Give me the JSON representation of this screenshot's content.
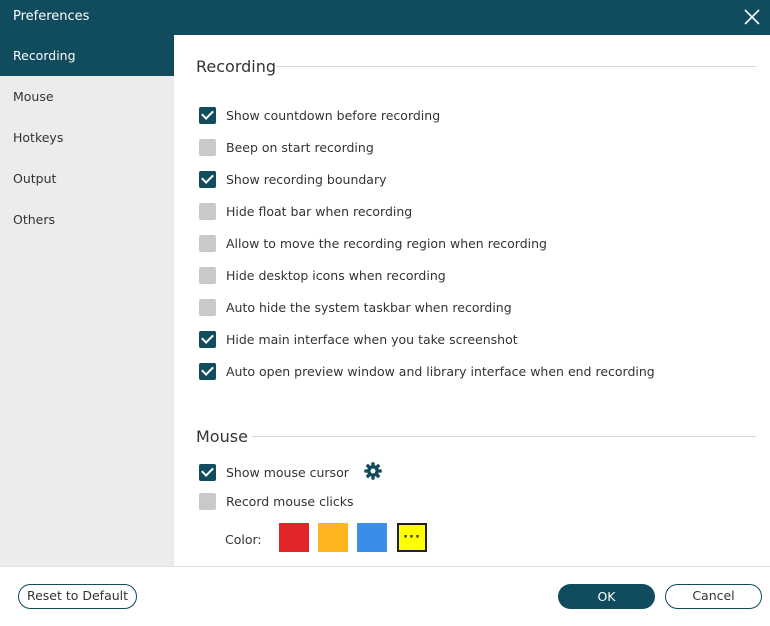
{
  "window": {
    "title": "Preferences",
    "close_icon": "close-icon"
  },
  "sidebar": {
    "items": [
      {
        "label": "Recording",
        "active": true
      },
      {
        "label": "Mouse",
        "active": false
      },
      {
        "label": "Hotkeys",
        "active": false
      },
      {
        "label": "Output",
        "active": false
      },
      {
        "label": "Others",
        "active": false
      }
    ]
  },
  "recording": {
    "title": "Recording",
    "options": [
      {
        "label": "Show countdown before recording",
        "checked": true
      },
      {
        "label": "Beep on start recording",
        "checked": false
      },
      {
        "label": "Show recording boundary",
        "checked": true
      },
      {
        "label": "Hide float bar when recording",
        "checked": false
      },
      {
        "label": "Allow to move the recording region when recording",
        "checked": false
      },
      {
        "label": "Hide desktop icons when recording",
        "checked": false
      },
      {
        "label": "Auto hide the system taskbar when recording",
        "checked": false
      },
      {
        "label": "Hide main interface when you take screenshot",
        "checked": true
      },
      {
        "label": "Auto open preview window and library interface when end recording",
        "checked": true
      }
    ]
  },
  "mouse": {
    "title": "Mouse",
    "options": [
      {
        "label": "Show mouse cursor",
        "checked": true,
        "settings_icon": "gear-icon"
      },
      {
        "label": "Record mouse clicks",
        "checked": false
      }
    ],
    "color_label": "Color:",
    "colors": [
      "#e0262b",
      "#fdb51e",
      "#3b8de7",
      "#ffff00"
    ],
    "more_colors_label": "···"
  },
  "footer": {
    "reset_label": "Reset to Default",
    "ok_label": "OK",
    "cancel_label": "Cancel"
  },
  "theme": {
    "accent": "#104b5e",
    "sidebar_bg": "#ececec",
    "unchecked": "#c9c9c9"
  }
}
